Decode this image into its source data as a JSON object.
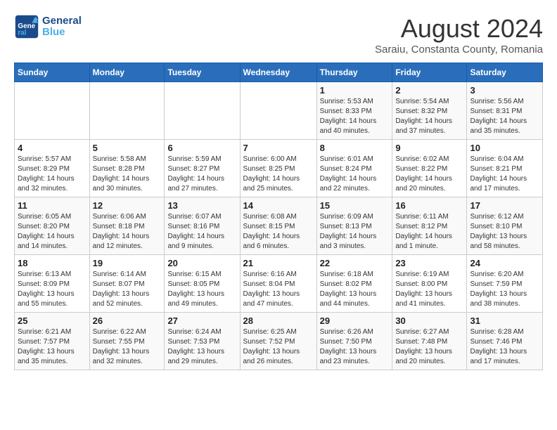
{
  "logo": {
    "text_general": "General",
    "text_blue": "Blue"
  },
  "title": "August 2024",
  "location": "Saraiu, Constanta County, Romania",
  "days_of_week": [
    "Sunday",
    "Monday",
    "Tuesday",
    "Wednesday",
    "Thursday",
    "Friday",
    "Saturday"
  ],
  "weeks": [
    [
      {
        "day": "",
        "info": ""
      },
      {
        "day": "",
        "info": ""
      },
      {
        "day": "",
        "info": ""
      },
      {
        "day": "",
        "info": ""
      },
      {
        "day": "1",
        "info": "Sunrise: 5:53 AM\nSunset: 8:33 PM\nDaylight: 14 hours\nand 40 minutes."
      },
      {
        "day": "2",
        "info": "Sunrise: 5:54 AM\nSunset: 8:32 PM\nDaylight: 14 hours\nand 37 minutes."
      },
      {
        "day": "3",
        "info": "Sunrise: 5:56 AM\nSunset: 8:31 PM\nDaylight: 14 hours\nand 35 minutes."
      }
    ],
    [
      {
        "day": "4",
        "info": "Sunrise: 5:57 AM\nSunset: 8:29 PM\nDaylight: 14 hours\nand 32 minutes."
      },
      {
        "day": "5",
        "info": "Sunrise: 5:58 AM\nSunset: 8:28 PM\nDaylight: 14 hours\nand 30 minutes."
      },
      {
        "day": "6",
        "info": "Sunrise: 5:59 AM\nSunset: 8:27 PM\nDaylight: 14 hours\nand 27 minutes."
      },
      {
        "day": "7",
        "info": "Sunrise: 6:00 AM\nSunset: 8:25 PM\nDaylight: 14 hours\nand 25 minutes."
      },
      {
        "day": "8",
        "info": "Sunrise: 6:01 AM\nSunset: 8:24 PM\nDaylight: 14 hours\nand 22 minutes."
      },
      {
        "day": "9",
        "info": "Sunrise: 6:02 AM\nSunset: 8:22 PM\nDaylight: 14 hours\nand 20 minutes."
      },
      {
        "day": "10",
        "info": "Sunrise: 6:04 AM\nSunset: 8:21 PM\nDaylight: 14 hours\nand 17 minutes."
      }
    ],
    [
      {
        "day": "11",
        "info": "Sunrise: 6:05 AM\nSunset: 8:20 PM\nDaylight: 14 hours\nand 14 minutes."
      },
      {
        "day": "12",
        "info": "Sunrise: 6:06 AM\nSunset: 8:18 PM\nDaylight: 14 hours\nand 12 minutes."
      },
      {
        "day": "13",
        "info": "Sunrise: 6:07 AM\nSunset: 8:16 PM\nDaylight: 14 hours\nand 9 minutes."
      },
      {
        "day": "14",
        "info": "Sunrise: 6:08 AM\nSunset: 8:15 PM\nDaylight: 14 hours\nand 6 minutes."
      },
      {
        "day": "15",
        "info": "Sunrise: 6:09 AM\nSunset: 8:13 PM\nDaylight: 14 hours\nand 3 minutes."
      },
      {
        "day": "16",
        "info": "Sunrise: 6:11 AM\nSunset: 8:12 PM\nDaylight: 14 hours\nand 1 minute."
      },
      {
        "day": "17",
        "info": "Sunrise: 6:12 AM\nSunset: 8:10 PM\nDaylight: 13 hours\nand 58 minutes."
      }
    ],
    [
      {
        "day": "18",
        "info": "Sunrise: 6:13 AM\nSunset: 8:09 PM\nDaylight: 13 hours\nand 55 minutes."
      },
      {
        "day": "19",
        "info": "Sunrise: 6:14 AM\nSunset: 8:07 PM\nDaylight: 13 hours\nand 52 minutes."
      },
      {
        "day": "20",
        "info": "Sunrise: 6:15 AM\nSunset: 8:05 PM\nDaylight: 13 hours\nand 49 minutes."
      },
      {
        "day": "21",
        "info": "Sunrise: 6:16 AM\nSunset: 8:04 PM\nDaylight: 13 hours\nand 47 minutes."
      },
      {
        "day": "22",
        "info": "Sunrise: 6:18 AM\nSunset: 8:02 PM\nDaylight: 13 hours\nand 44 minutes."
      },
      {
        "day": "23",
        "info": "Sunrise: 6:19 AM\nSunset: 8:00 PM\nDaylight: 13 hours\nand 41 minutes."
      },
      {
        "day": "24",
        "info": "Sunrise: 6:20 AM\nSunset: 7:59 PM\nDaylight: 13 hours\nand 38 minutes."
      }
    ],
    [
      {
        "day": "25",
        "info": "Sunrise: 6:21 AM\nSunset: 7:57 PM\nDaylight: 13 hours\nand 35 minutes."
      },
      {
        "day": "26",
        "info": "Sunrise: 6:22 AM\nSunset: 7:55 PM\nDaylight: 13 hours\nand 32 minutes."
      },
      {
        "day": "27",
        "info": "Sunrise: 6:24 AM\nSunset: 7:53 PM\nDaylight: 13 hours\nand 29 minutes."
      },
      {
        "day": "28",
        "info": "Sunrise: 6:25 AM\nSunset: 7:52 PM\nDaylight: 13 hours\nand 26 minutes."
      },
      {
        "day": "29",
        "info": "Sunrise: 6:26 AM\nSunset: 7:50 PM\nDaylight: 13 hours\nand 23 minutes."
      },
      {
        "day": "30",
        "info": "Sunrise: 6:27 AM\nSunset: 7:48 PM\nDaylight: 13 hours\nand 20 minutes."
      },
      {
        "day": "31",
        "info": "Sunrise: 6:28 AM\nSunset: 7:46 PM\nDaylight: 13 hours\nand 17 minutes."
      }
    ]
  ]
}
